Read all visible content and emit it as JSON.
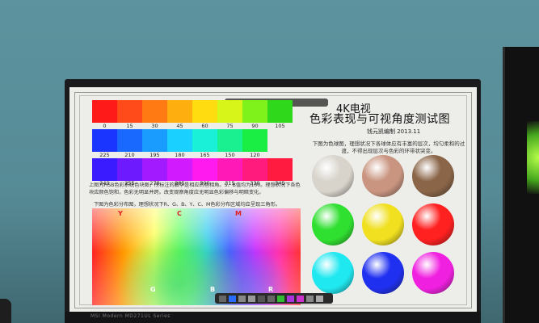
{
  "title_line1": "4K电视",
  "title_line2": "色彩表现与可视角度测试图",
  "subtitle": "钱元凯编制  2013.11",
  "para_right": "下图为色球图，理想状况下各球体应有丰富的层次，均匀柔和的过渡，不得出现层次与色彩的环带状突变。",
  "para_left": "上图为HSB色彩系统色块图，所标注的数字是相应的色相角。S、B值均为100。理想状况下各色块应颜色饱和，色彩无明显并跨。改变观察角度应无明显色彩偏移与明暗变化。",
  "para_left2": "下图为色彩分布图，理想状况下R、G、B、Y、C、M色彩分布区域均应呈现三角形。",
  "row1_labels": [
    "0",
    "15",
    "30",
    "45",
    "60",
    "75",
    "90",
    "105"
  ],
  "row2_labels": [
    "225",
    "210",
    "195",
    "180",
    "165",
    "150",
    "120"
  ],
  "row3_labels": [
    "240",
    "255",
    "270",
    "285",
    "300",
    "315",
    "330",
    "345"
  ],
  "spectrum_labels": {
    "y": "Y",
    "c": "C",
    "m": "M",
    "g": "G",
    "b": "B",
    "r": "R"
  },
  "brand": "MSI  Modern MD271UL Series",
  "colors": {
    "row1": [
      "#ff1a1a",
      "#ff4a1a",
      "#ff7a12",
      "#ffae10",
      "#ffdc10",
      "#d8f51a",
      "#7ef21a",
      "#2fd81a"
    ],
    "row2": [
      "#1a35ff",
      "#1a69ff",
      "#1a9cff",
      "#1ad0ff",
      "#1af0d8",
      "#1af090",
      "#1aee45"
    ],
    "row3": [
      "#3a1aff",
      "#6e1aff",
      "#a21aff",
      "#d21aff",
      "#ff1af0",
      "#ff1ab8",
      "#ff1a7e",
      "#ff1a40"
    ],
    "balls": [
      "#d8d4cc",
      "#c99580",
      "#8a6548",
      "#30e030",
      "#f0e020",
      "#ff2020",
      "#20e8f0",
      "#2030f0",
      "#f020e0"
    ]
  }
}
